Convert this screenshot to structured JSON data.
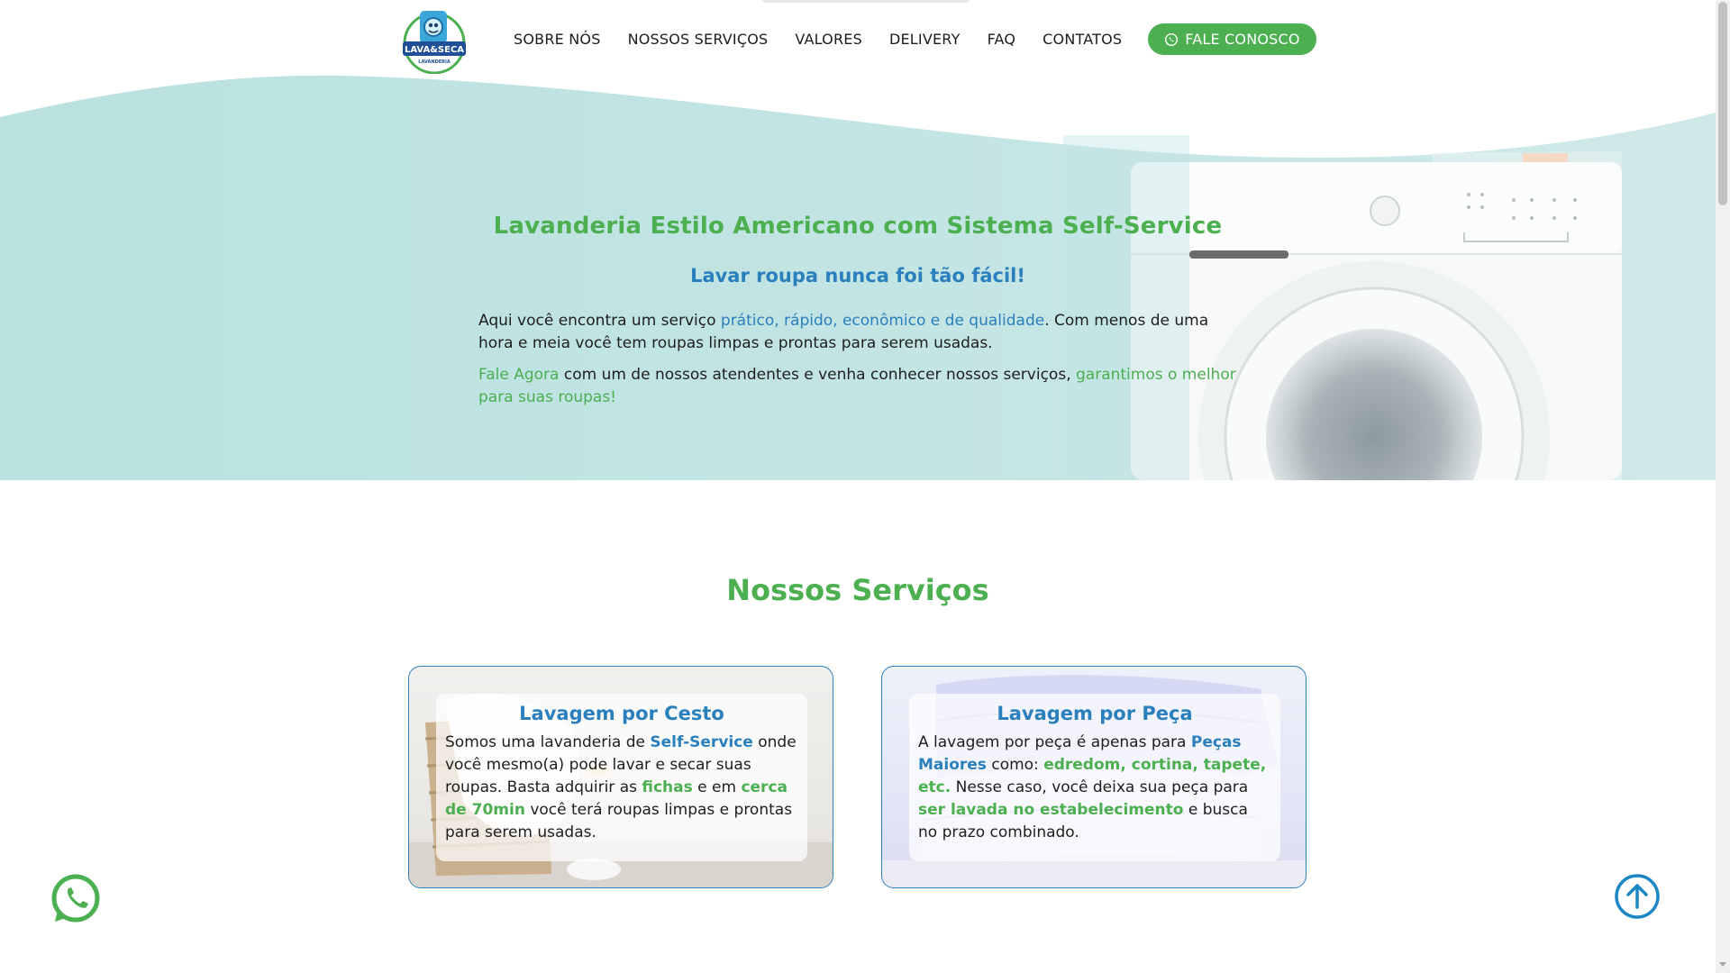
{
  "header": {
    "logo": {
      "icon": "washing-machine-mascot-icon",
      "text_line1": "LAVA&SECA",
      "text_line2": "LAVANDERIA"
    },
    "nav": [
      {
        "label": "SOBRE NÓS"
      },
      {
        "label": "NOSSOS SERVIÇOS"
      },
      {
        "label": "VALORES"
      },
      {
        "label": "DELIVERY"
      },
      {
        "label": "FAQ"
      },
      {
        "label": "CONTATOS"
      }
    ],
    "cta": {
      "label": "FALE CONOSCO",
      "icon": "whatsapp-icon"
    }
  },
  "hero": {
    "title": "Lavanderia Estilo Americano com Sistema Self-Service",
    "subtitle": "Lavar roupa nunca foi tão fácil!",
    "p1": {
      "t1": "Aqui você encontra um serviço ",
      "h1": "prático, rápido, econômico e de qualidade",
      "t2": ". Com menos de uma hora e meia você tem roupas limpas e prontas para serem usadas."
    },
    "p2": {
      "h1": "Fale Agora",
      "t1": " com um de nossos atendentes e venha conhecer nossos serviços, ",
      "h2": "garantimos o melhor para suas roupas!"
    },
    "image": "washing-machine-photo"
  },
  "services": {
    "title": "Nossos Serviços",
    "cards": [
      {
        "title": "Lavagem por Cesto",
        "image": "laundry-basket-photo",
        "t1": "Somos uma lavanderia de ",
        "h1": "Self-Service",
        "t2": " onde você mesmo(a) pode lavar e secar suas roupas. Basta adquirir as ",
        "h2": "fichas",
        "t3": " e em ",
        "h3": "cerca de 70min",
        "t4": " você terá roupas limpas e prontas para serem usadas."
      },
      {
        "title": "Lavagem por Peça",
        "image": "folded-duvet-photo",
        "t1": "A lavagem por peça é apenas para ",
        "h1": "Peças Maiores",
        "t2": " como: ",
        "h2": "edredom, cortina, tapete, etc.",
        "t3": " Nesse caso, você deixa sua peça para ",
        "h3": "ser lavada no estabelecimento",
        "t4": " e busca no prazo combinado."
      }
    ]
  },
  "floating": {
    "whatsapp_icon": "whatsapp-icon",
    "back_to_top_icon": "arrow-up-circle-icon"
  },
  "colors": {
    "green": "#4caf50",
    "blue": "#2a7fbd",
    "hero_teal": "#bfe3e3"
  }
}
